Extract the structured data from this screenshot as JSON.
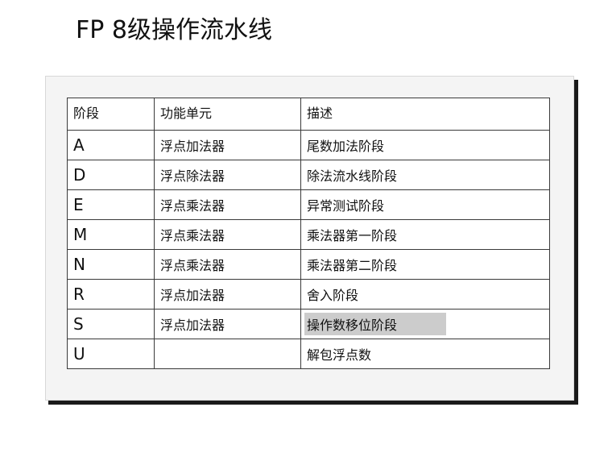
{
  "title": "FP 8级操作流水线",
  "table": {
    "headers": [
      "阶段",
      "功能单元",
      "描述"
    ],
    "rows": [
      {
        "stage": "A",
        "unit": "浮点加法器",
        "desc": "尾数加法阶段"
      },
      {
        "stage": "D",
        "unit": "浮点除法器",
        "desc": "除法流水线阶段"
      },
      {
        "stage": "E",
        "unit": "浮点乘法器",
        "desc": "异常测试阶段"
      },
      {
        "stage": "M",
        "unit": "浮点乘法器",
        "desc": "乘法器第一阶段"
      },
      {
        "stage": "N",
        "unit": "浮点乘法器",
        "desc": "乘法器第二阶段"
      },
      {
        "stage": "R",
        "unit": "浮点加法器",
        "desc": "舍入阶段"
      },
      {
        "stage": "S",
        "unit": "浮点加法器",
        "desc": "操作数移位阶段"
      },
      {
        "stage": "U",
        "unit": "",
        "desc": "解包浮点数"
      }
    ]
  },
  "colors": {
    "highlight": "#cccccc",
    "card_background": "#f4f4f4",
    "shadow": "#1a1a1a"
  }
}
